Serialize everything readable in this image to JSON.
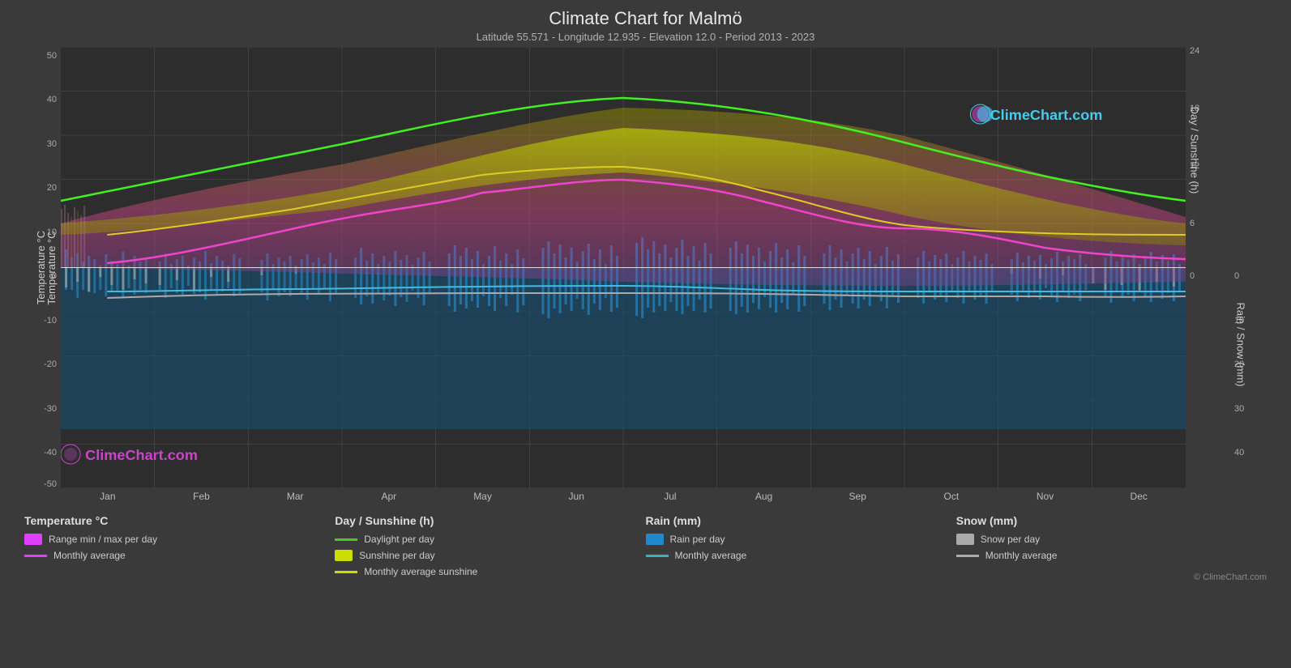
{
  "header": {
    "title": "Climate Chart for Malmö",
    "subtitle": "Latitude 55.571 - Longitude 12.935 - Elevation 12.0 - Period 2013 - 2023"
  },
  "watermark_top": "ClimeChart.com",
  "watermark_bottom": "ClimeChart.com",
  "copyright": "© ClimeChart.com",
  "y_axis_left": {
    "label": "Temperature °C",
    "ticks": [
      50,
      40,
      30,
      20,
      10,
      0,
      -10,
      -20,
      -30,
      -40,
      -50
    ]
  },
  "y_axis_right1": {
    "label": "Day / Sunshine (h)",
    "ticks": [
      24,
      18,
      12,
      6,
      0
    ]
  },
  "y_axis_right2": {
    "label": "Rain / Snow (mm)",
    "ticks": [
      0,
      10,
      20,
      30,
      40
    ]
  },
  "months": [
    "Jan",
    "Feb",
    "Mar",
    "Apr",
    "May",
    "Jun",
    "Jul",
    "Aug",
    "Sep",
    "Oct",
    "Nov",
    "Dec"
  ],
  "legend": {
    "col1": {
      "title": "Temperature °C",
      "items": [
        {
          "type": "swatch",
          "color": "#e040fb",
          "label": "Range min / max per day"
        },
        {
          "type": "line",
          "color": "#e040fb",
          "label": "Monthly average"
        }
      ]
    },
    "col2": {
      "title": "Day / Sunshine (h)",
      "items": [
        {
          "type": "line",
          "color": "#44cc22",
          "label": "Daylight per day"
        },
        {
          "type": "swatch",
          "color": "#ccdd00",
          "label": "Sunshine per day"
        },
        {
          "type": "line",
          "color": "#ccdd00",
          "label": "Monthly average sunshine"
        }
      ]
    },
    "col3": {
      "title": "Rain (mm)",
      "items": [
        {
          "type": "swatch",
          "color": "#2288cc",
          "label": "Rain per day"
        },
        {
          "type": "line",
          "color": "#44aacc",
          "label": "Monthly average"
        }
      ]
    },
    "col4": {
      "title": "Snow (mm)",
      "items": [
        {
          "type": "swatch",
          "color": "#aaaaaa",
          "label": "Snow per day"
        },
        {
          "type": "line",
          "color": "#aaaaaa",
          "label": "Monthly average"
        }
      ]
    }
  }
}
